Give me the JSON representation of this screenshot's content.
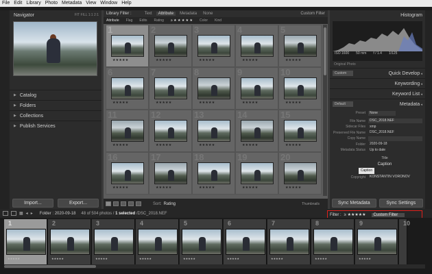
{
  "menu": [
    "File",
    "Edit",
    "Library",
    "Photo",
    "Metadata",
    "View",
    "Window",
    "Help"
  ],
  "left": {
    "navigator": "Navigator",
    "zoom": "FIT  FILL  1:1  2:1",
    "sections": [
      "Catalog",
      "Folders",
      "Collections",
      "Publish Services"
    ],
    "import": "Import...",
    "export": "Export..."
  },
  "filter_bar": {
    "title": "Library Filter :",
    "tabs": [
      "Text",
      "Attribute",
      "Metadata",
      "None"
    ],
    "custom": "Custom Filter"
  },
  "attr_bar": {
    "attribute": "Attribute",
    "flag": "Flag",
    "edits": "Edits",
    "rating": "Rating",
    "stars": "≥  ★ ★ ★ ★ ★",
    "color": "Color",
    "kind": "Kind"
  },
  "grid": {
    "numbers": [
      "1",
      "2",
      "3",
      "4",
      "5",
      "6",
      "7",
      "8",
      "9",
      "10",
      "11",
      "12",
      "13",
      "14",
      "15",
      "16",
      "17",
      "18",
      "19",
      "20"
    ],
    "stars": "★★★★★"
  },
  "toolbar": {
    "sort_label": "Sort:",
    "sort_value": "Rating",
    "thumbnails": "Thumbnails"
  },
  "right": {
    "histogram": "Histogram",
    "iso": "ISO 1600",
    "focal": "50 mm",
    "aperture": "f / 1.4",
    "shutter": "1/125",
    "original": "Original Photo",
    "quick_preset": "Custom",
    "quick_develop": "Quick Develop",
    "keywording": "Keywording",
    "keyword_list": "Keyword List",
    "meta_preset": "Default",
    "metadata": "Metadata",
    "preset_label": "Preset",
    "preset_value": "None",
    "fields": [
      {
        "k": "File Name",
        "v": "DSC_2018.NEF"
      },
      {
        "k": "Sidecar Files",
        "v": "xmp"
      },
      {
        "k": "Preserved File Name",
        "v": "DSC_2018.NEF"
      },
      {
        "k": "Copy Name",
        "v": ""
      },
      {
        "k": "Folder",
        "v": "2020-09-18"
      },
      {
        "k": "Metadata Status",
        "v": "Up to date"
      }
    ],
    "title_label": "Title",
    "caption_label": "Caption",
    "caption_tip": "Caption",
    "copyright_label": "Copyright",
    "copyright_value": "KONSTANTIN VORONOV",
    "sync_metadata": "Sync Metadata",
    "sync_settings": "Sync Settings"
  },
  "filmstrip_bar": {
    "page1": "1",
    "page2": "2",
    "folder": "Folder : 2020-09-18",
    "count": "48 of 504 photos /",
    "selected": "1 selected",
    "file": "/DSC_2018.NEF",
    "filter_label": "Filter :",
    "filter_stars": "≥ ★★★★★",
    "filter_value": "Custom Filter"
  },
  "filmstrip": {
    "numbers": [
      "1",
      "2",
      "3",
      "4",
      "5",
      "6",
      "7",
      "8",
      "9",
      "10"
    ],
    "stars": "★★★★★"
  }
}
